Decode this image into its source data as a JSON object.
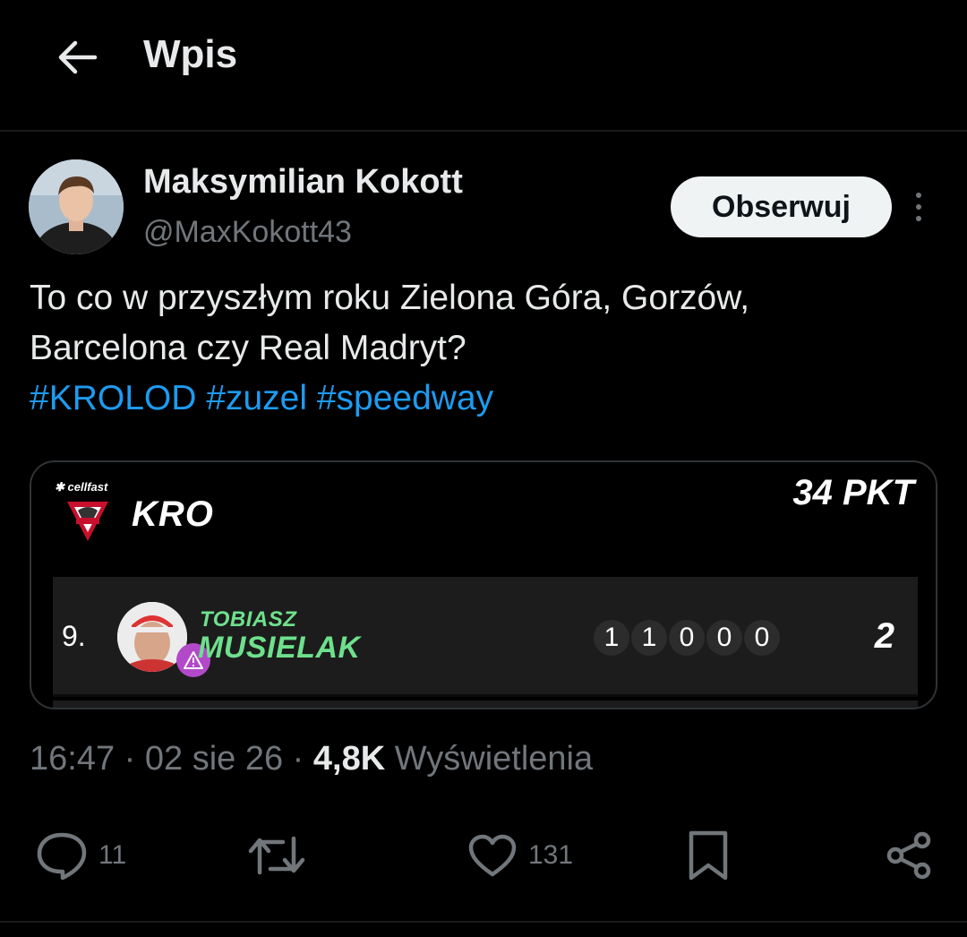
{
  "header": {
    "title": "Wpis"
  },
  "author": {
    "name": "Maksymilian Kokott",
    "handle": "@MaxKokott43",
    "follow_label": "Obserwuj"
  },
  "tweet": {
    "lines": [
      "To co w przyszłym roku Zielona Góra, Gorzów,",
      "Barcelona czy Real Madryt?"
    ],
    "hashtags": [
      "#KROLOD",
      "#zuzel",
      "#speedway"
    ]
  },
  "media": {
    "sponsor": "cellfast",
    "team_code": "KRO",
    "team_points": "34 PKT",
    "rider": {
      "position": "9.",
      "first_name": "TOBIASZ",
      "last_name": "MUSIELAK",
      "heats": [
        "1",
        "1",
        "0",
        "0",
        "0"
      ],
      "total": "2"
    },
    "colors": {
      "rider_name": "#6ee08d",
      "warning_badge": "#b249c9"
    }
  },
  "meta": {
    "time": "16:47",
    "date": "02 sie 26",
    "views_count": "4,8K",
    "views_label": "Wyświetlenia"
  },
  "actions": {
    "replies": "11",
    "likes": "131"
  },
  "colors": {
    "background": "#000000",
    "hashtag": "#1d9bf0",
    "muted": "#71767b",
    "text": "#e7e9ea"
  }
}
